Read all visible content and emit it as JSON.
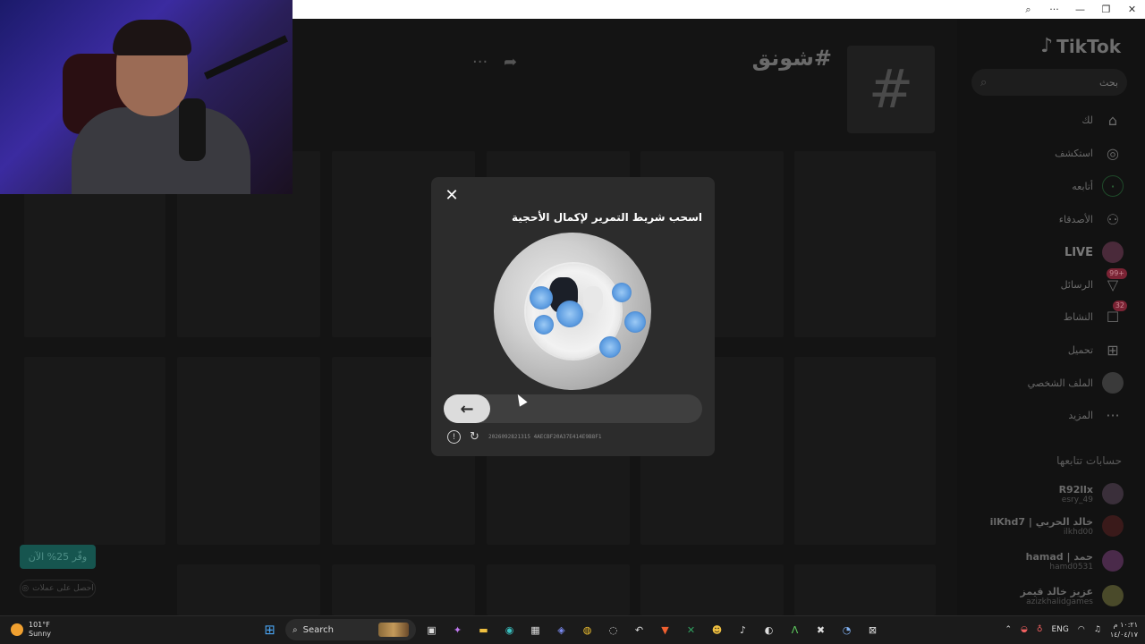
{
  "window": {
    "zoom_icon": "zoom-icon",
    "more_icon": "more-icon",
    "minimize": "—",
    "maximize": "❐",
    "close": "✕"
  },
  "header": {
    "hashtag_title": "#شونق",
    "hash_symbol": "#",
    "more": "···",
    "share": "➦"
  },
  "sidebar": {
    "logo": "TikTok",
    "search_placeholder": "بحث",
    "nav": [
      {
        "label": "لك",
        "icon": "home-icon"
      },
      {
        "label": "استكشف",
        "icon": "compass-icon"
      },
      {
        "label": "أتابعه",
        "icon": "following-icon"
      },
      {
        "label": "الأصدقاء",
        "icon": "friends-icon"
      },
      {
        "label": "LIVE",
        "icon": "live-icon"
      },
      {
        "label": "الرسائل",
        "icon": "messages-icon",
        "badge": "+99"
      },
      {
        "label": "النشاط",
        "icon": "activity-icon",
        "badge": "32"
      },
      {
        "label": "تحميل",
        "icon": "upload-icon"
      },
      {
        "label": "الملف الشخصي",
        "icon": "profile-icon"
      },
      {
        "label": "المزيد",
        "icon": "more-icon"
      }
    ],
    "following_title": "حسابات تتابعها",
    "accounts": [
      {
        "name": "R92llx",
        "handle": "esry_49"
      },
      {
        "name": "خالد الحربي | ilKhd7",
        "handle": "ilkhd00"
      },
      {
        "name": "حمد | hamad",
        "handle": "hamd0531"
      },
      {
        "name": "عزيز خالد قيمز",
        "handle": "azizkhalidgames"
      }
    ]
  },
  "promo": {
    "label": "وفّر 25% الآن",
    "sub": "احصل على عملات"
  },
  "captcha": {
    "title": "اسحب شريط التمرير لإكمال الأحجية",
    "close": "✕",
    "slider_arrow": "←",
    "info": "!",
    "refresh": "↻",
    "code": "2026092821315 4AECBF20A37E414E9B8F1"
  },
  "taskbar": {
    "temp": "101°F",
    "condition": "Sunny",
    "search": "Search",
    "lang": "ENG",
    "time": "١٠:٢١ م",
    "date": "١٤/٠٤/١٧"
  }
}
